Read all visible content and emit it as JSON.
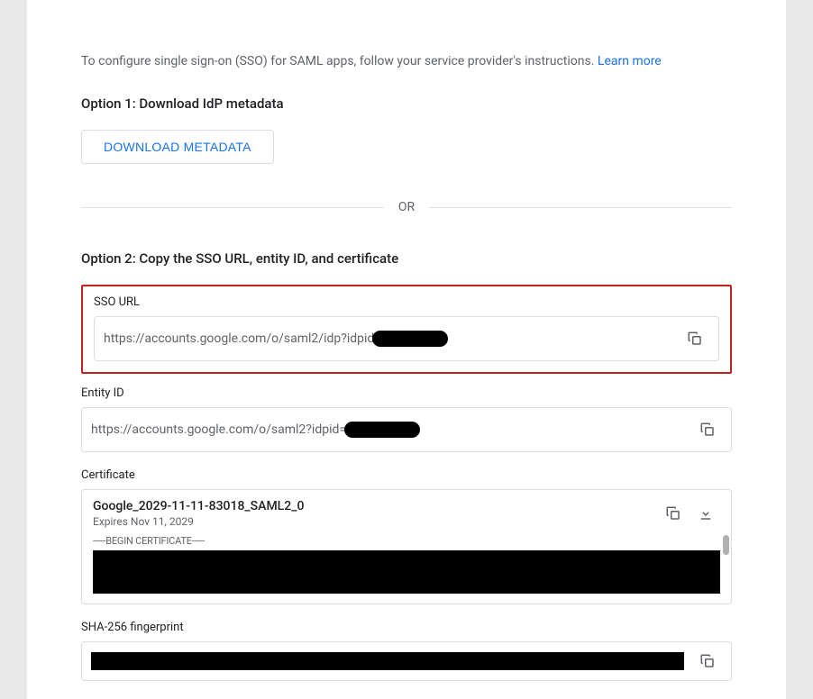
{
  "intro": {
    "text": "To configure single sign-on (SSO) for SAML apps, follow your service provider's instructions. ",
    "link_label": "Learn more"
  },
  "option1": {
    "title": "Option 1: Download IdP metadata",
    "button_label": "DOWNLOAD METADATA"
  },
  "divider_label": "OR",
  "option2": {
    "title": "Option 2: Copy the SSO URL, entity ID, and certificate"
  },
  "sso_url": {
    "label": "SSO URL",
    "value_prefix": "https://accounts.google.com/o/saml2/idp?idpid"
  },
  "entity_id": {
    "label": "Entity ID",
    "value_prefix": "https://accounts.google.com/o/saml2?idpid="
  },
  "certificate": {
    "label": "Certificate",
    "name": "Google_2029-11-11-83018_SAML2_0",
    "expires": "Expires Nov 11, 2029",
    "begin_line": "-----BEGIN CERTIFICATE-----"
  },
  "fingerprint": {
    "label": "SHA-256 fingerprint"
  }
}
